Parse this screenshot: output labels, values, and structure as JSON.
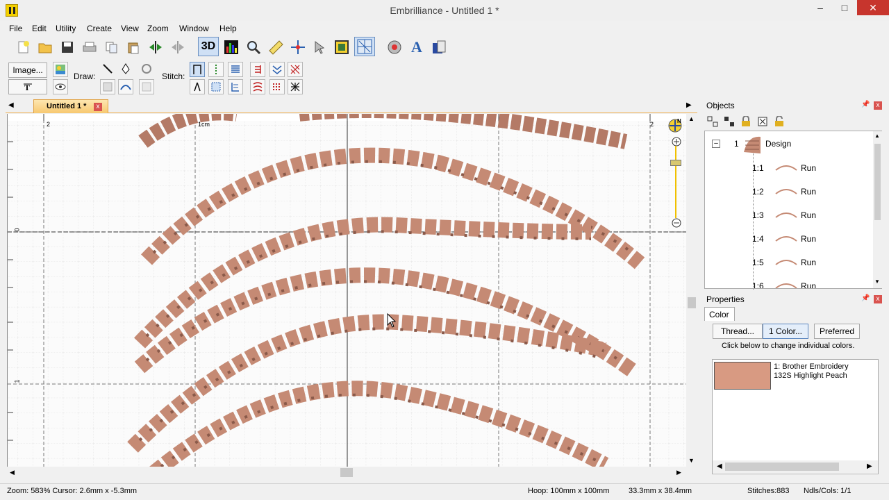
{
  "window": {
    "title": "Embrilliance -  Untitled 1 *",
    "minimize": "–",
    "maximize": "□",
    "close": "✕"
  },
  "menu": [
    "File",
    "Edit",
    "Utility",
    "Create",
    "View",
    "Zoom",
    "Window",
    "Help"
  ],
  "toolbar": {
    "3d_label": "3D",
    "text_icon": "A"
  },
  "toolbar2": {
    "image_button": "Image...",
    "draw_label": "Draw:",
    "stitch_label": "Stitch:"
  },
  "document_tab": {
    "label": "Untitled 1 *",
    "close": "x"
  },
  "rulers": {
    "h_labels": [
      "2",
      "1cm",
      "2"
    ],
    "v_labels": [
      "0",
      "1"
    ]
  },
  "objects_panel": {
    "title": "Objects",
    "design_index": "1",
    "design_label": "Design",
    "items": [
      {
        "index": "1:1",
        "label": "Run"
      },
      {
        "index": "1:2",
        "label": "Run"
      },
      {
        "index": "1:3",
        "label": "Run"
      },
      {
        "index": "1:4",
        "label": "Run"
      },
      {
        "index": "1:5",
        "label": "Run"
      },
      {
        "index": "1:6",
        "label": "Run"
      }
    ]
  },
  "properties_panel": {
    "title": "Properties",
    "tab": "Color",
    "thread_button": "Thread...",
    "one_color_button": "1 Color...",
    "preferred_button": "Preferred",
    "hint": "Click below to change individual colors.",
    "color_entry": {
      "line1": "1: Brother Embroidery",
      "line2": "132S Highlight Peach",
      "swatch": "#d89a82"
    }
  },
  "status": {
    "zoom_cursor": "Zoom: 583%  Cursor: 2.6mm x -5.3mm",
    "hoop": "Hoop: 100mm x 100mm",
    "size": "33.3mm x 38.4mm",
    "stitches": "Stitches:883",
    "ndls": "Ndls/Cols: 1/1"
  },
  "colors": {
    "stitch": "#c58a74",
    "stitch_dark": "#8a5a4a",
    "tab_accent": "#f7c870"
  }
}
